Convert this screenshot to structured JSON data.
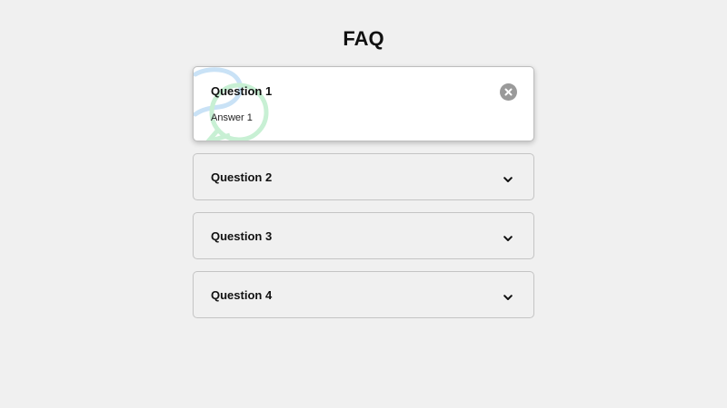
{
  "page": {
    "title": "FAQ"
  },
  "faqs": [
    {
      "question": "Question 1",
      "answer": "Answer 1",
      "expanded": true,
      "toggle_icon": "close-icon"
    },
    {
      "question": "Question 2",
      "expanded": false,
      "toggle_icon": "chevron-down-icon"
    },
    {
      "question": "Question 3",
      "expanded": false,
      "toggle_icon": "chevron-down-icon"
    },
    {
      "question": "Question 4",
      "expanded": false,
      "toggle_icon": "chevron-down-icon"
    }
  ],
  "colors": {
    "background": "#f0f0f0",
    "open_card": "#ffffff",
    "close_button": "#9a9a9a",
    "bubble_blue": "#c9e2f6",
    "bubble_green": "#c8f0d4"
  }
}
